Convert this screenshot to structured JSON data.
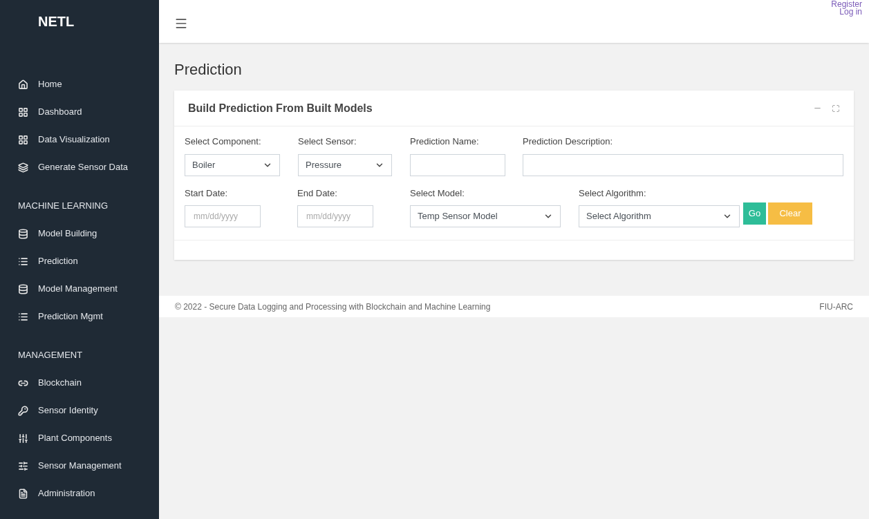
{
  "sidebar": {
    "brand": "NETL",
    "groups": [
      {
        "items": [
          {
            "label": "Home"
          },
          {
            "label": "Dashboard"
          },
          {
            "label": "Data Visualization"
          },
          {
            "label": "Generate Sensor Data"
          }
        ]
      },
      {
        "heading": "MACHINE LEARNING",
        "items": [
          {
            "label": "Model Building"
          },
          {
            "label": "Prediction"
          },
          {
            "label": "Model Management"
          },
          {
            "label": "Prediction Mgmt"
          }
        ]
      },
      {
        "heading": "MANAGEMENT",
        "items": [
          {
            "label": "Blockchain"
          },
          {
            "label": "Sensor Identity"
          },
          {
            "label": "Plant Components"
          },
          {
            "label": "Sensor Management"
          },
          {
            "label": "Administration"
          }
        ]
      }
    ]
  },
  "header": {
    "links": [
      "Register",
      "Log in"
    ]
  },
  "page_title": "Prediction",
  "card": {
    "title": "Build Prediction From Built Models",
    "rows": [
      [
        {
          "kind": "select",
          "label": "Select Component:",
          "value": "Boiler"
        },
        {
          "kind": "select",
          "label": "Select Sensor:",
          "value": "Pressure"
        },
        {
          "kind": "input",
          "label": "Prediction Name:"
        },
        {
          "kind": "input",
          "label": "Prediction Description:"
        }
      ],
      [
        {
          "kind": "date",
          "label": "Start Date:",
          "placeholder": "mm/dd/yyyy"
        },
        {
          "kind": "date",
          "label": "End Date:",
          "placeholder": "mm/dd/yyyy"
        },
        {
          "kind": "select",
          "label": "Select Model:",
          "value": "Temp Sensor Model"
        },
        {
          "kind": "select",
          "label": "Select Algorithm:",
          "value": "Select Algorithm"
        }
      ]
    ],
    "buttons": [
      {
        "kind": "go",
        "label": "Go"
      },
      {
        "kind": "clear",
        "label": "Clear"
      }
    ]
  },
  "footer": {
    "copyright": "© 2022 - Secure Data Logging and Processing with Blockchain and Machine Learning",
    "org": "FIU-ARC"
  }
}
